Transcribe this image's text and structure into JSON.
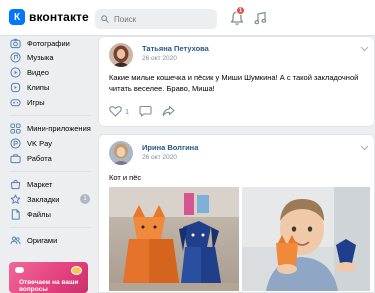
{
  "header": {
    "logo_text": "вконтакте",
    "logo_letter": "К",
    "search_placeholder": "Поиск",
    "notifications_badge": "1"
  },
  "sidebar": {
    "items": [
      {
        "label": "Фотографии",
        "icon": "photo-icon"
      },
      {
        "label": "Музыка",
        "icon": "music-icon"
      },
      {
        "label": "Видео",
        "icon": "video-icon"
      },
      {
        "label": "Клипы",
        "icon": "clips-icon"
      },
      {
        "label": "Игры",
        "icon": "games-icon"
      },
      {
        "label": "Мини-приложения",
        "icon": "mini-apps-icon"
      },
      {
        "label": "VK Pay",
        "icon": "vk-pay-icon"
      },
      {
        "label": "Работа",
        "icon": "work-icon"
      },
      {
        "label": "Маркет",
        "icon": "market-icon"
      },
      {
        "label": "Закладки",
        "icon": "bookmarks-icon",
        "count": "1"
      },
      {
        "label": "Файлы",
        "icon": "files-icon"
      },
      {
        "label": "Оригами",
        "icon": "community-icon"
      }
    ],
    "ad_text": "Отвечаем на ваши вопросы"
  },
  "feed": {
    "posts": [
      {
        "author": "Татьяна Петухова",
        "date": "26 окт 2020",
        "text": "Какие милые кошечка и пёсик у Миши Шумкина! А с такой закладочной читать веселее. Браво, Миша!",
        "likes": "1"
      },
      {
        "author": "Ирина Волгина",
        "date": "26 окт 2020",
        "text": "Кот и пёс"
      }
    ]
  },
  "colors": {
    "accent": "#0077ff",
    "link": "#2a5885",
    "muted": "#818c99",
    "badge": "#e64646",
    "background": "#edeef0"
  }
}
